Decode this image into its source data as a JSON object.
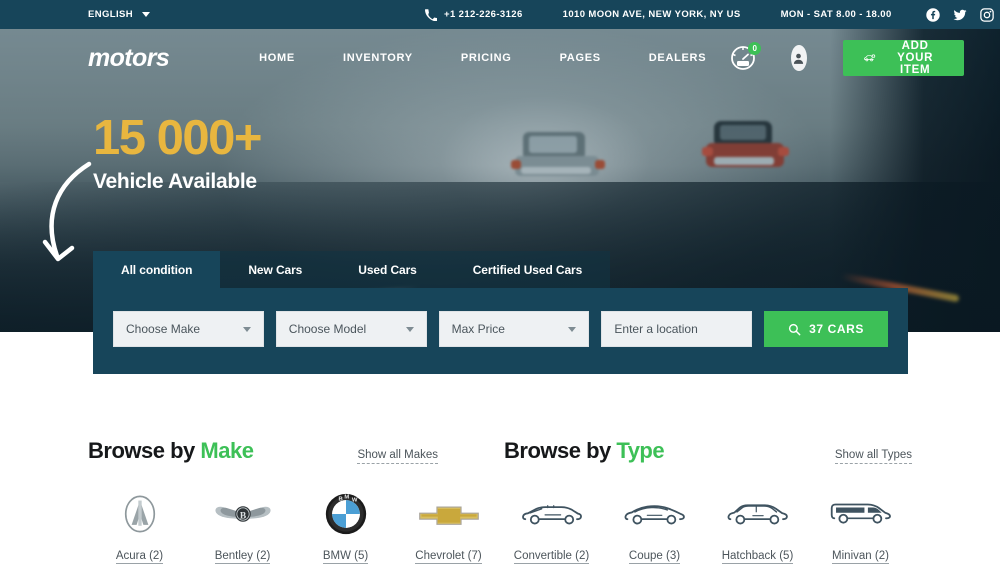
{
  "topbar": {
    "language": "ENGLISH",
    "phone": "+1 212-226-3126",
    "address": "1010 MOON AVE, NEW YORK, NY US",
    "hours": "MON - SAT 8.00 - 18.00",
    "socials": [
      "facebook-icon",
      "twitter-icon",
      "instagram-icon",
      "linkedin-icon",
      "googleplus-icon"
    ],
    "bg_color": "#17455a"
  },
  "header": {
    "logo": "motors",
    "nav": [
      {
        "label": "HOME"
      },
      {
        "label": "INVENTORY"
      },
      {
        "label": "PRICING"
      },
      {
        "label": "PAGES"
      },
      {
        "label": "DEALERS"
      }
    ],
    "compare_count": "0",
    "add_item_label": "ADD YOUR ITEM",
    "accent_color": "#3dc057"
  },
  "hero": {
    "headline_number": "15 000+",
    "headline_sub": "Vehicle Available",
    "number_color": "#e8b63f"
  },
  "search": {
    "tabs": [
      {
        "label": "All condition",
        "active": true
      },
      {
        "label": "New Cars",
        "active": false
      },
      {
        "label": "Used Cars",
        "active": false
      },
      {
        "label": "Certified Used Cars",
        "active": false
      }
    ],
    "make_placeholder": "Choose Make",
    "model_placeholder": "Choose Model",
    "price_placeholder": "Max Price",
    "location_placeholder": "Enter a location",
    "location_value": "",
    "submit_label": "37 CARS"
  },
  "browse_make": {
    "title_prefix": "Browse by",
    "title_accent": "Make",
    "show_all": "Show all Makes",
    "items": [
      {
        "label": "Acura (2)",
        "icon": "acura-logo"
      },
      {
        "label": "Bentley (2)",
        "icon": "bentley-logo"
      },
      {
        "label": "BMW (5)",
        "icon": "bmw-logo"
      },
      {
        "label": "Chevrolet (7)",
        "icon": "chevrolet-logo"
      }
    ]
  },
  "browse_type": {
    "title_prefix": "Browse by",
    "title_accent": "Type",
    "show_all": "Show all Types",
    "items": [
      {
        "label": "Convertible (2)",
        "icon": "convertible-icon"
      },
      {
        "label": "Coupe (3)",
        "icon": "coupe-icon"
      },
      {
        "label": "Hatchback (5)",
        "icon": "hatchback-icon"
      },
      {
        "label": "Minivan (2)",
        "icon": "minivan-icon"
      }
    ]
  }
}
